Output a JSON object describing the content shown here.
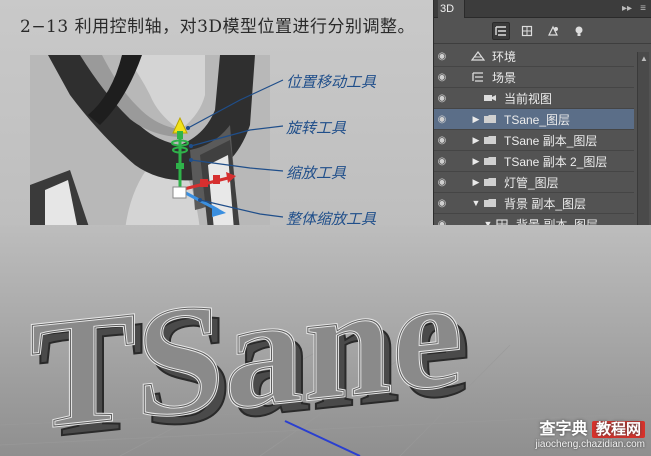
{
  "caption": "2−13 利用控制轴，对3D模型位置进行分别调整。",
  "annotations": {
    "move": "位置移动工具",
    "rotate": "旋转工具",
    "scale": "缩放工具",
    "uniform_scale": "整体缩放工具"
  },
  "panel": {
    "tab": "3D",
    "collapse_glyph": "▸▸",
    "menu_glyph": "≡",
    "toolbar": [
      "scene-filter",
      "mesh-filter",
      "material-filter",
      "light-filter"
    ],
    "layers": [
      {
        "label": "环境",
        "icon": "environment-icon",
        "indent": 0,
        "arrow": "",
        "eye": true,
        "selected": false
      },
      {
        "label": "场景",
        "icon": "scene-icon",
        "indent": 0,
        "arrow": "",
        "eye": true,
        "selected": false
      },
      {
        "label": "当前视图",
        "icon": "camera-icon",
        "indent": 1,
        "arrow": "",
        "eye": true,
        "selected": false
      },
      {
        "label": "TSane_图层",
        "icon": "folder-icon",
        "indent": 1,
        "arrow": "▶",
        "eye": true,
        "selected": true
      },
      {
        "label": "TSane 副本_图层",
        "icon": "folder-icon",
        "indent": 1,
        "arrow": "▶",
        "eye": true,
        "selected": false
      },
      {
        "label": "TSane 副本 2_图层",
        "icon": "folder-icon",
        "indent": 1,
        "arrow": "▶",
        "eye": true,
        "selected": false
      },
      {
        "label": "灯管_图层",
        "icon": "folder-icon",
        "indent": 1,
        "arrow": "▶",
        "eye": true,
        "selected": false
      },
      {
        "label": "背景 副本_图层",
        "icon": "folder-icon",
        "indent": 1,
        "arrow": "▼",
        "eye": true,
        "selected": false
      },
      {
        "label": "背景 副本_图层",
        "icon": "mesh-icon",
        "indent": 2,
        "arrow": "▼",
        "eye": true,
        "selected": false
      }
    ]
  },
  "scene": {
    "text_3d": "TSane",
    "accent_color": "#5b6e88"
  },
  "watermark": {
    "brand": "查字典",
    "badge": "教程网",
    "url": "jiaocheng.chazidian.com"
  }
}
